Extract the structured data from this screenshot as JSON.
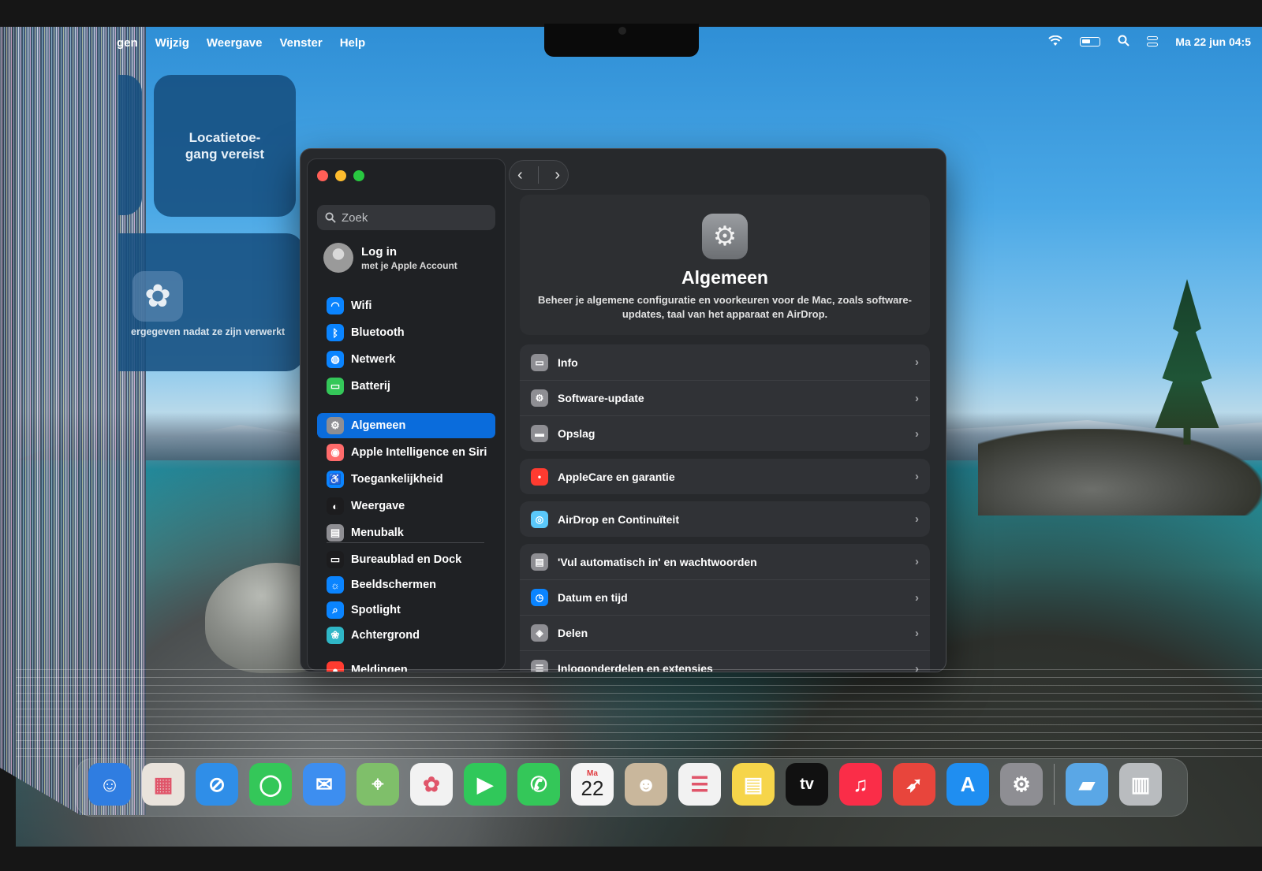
{
  "menubar": {
    "items": [
      "gen",
      "Wijzig",
      "Weergave",
      "Venster",
      "Help"
    ],
    "datetime": "Ma 22 jun 04:5"
  },
  "widgets": {
    "location_text": "Locatietoe-gang vereist",
    "photos_caption": "ergegeven nadat ze zijn verwerkt"
  },
  "sidebar": {
    "search_placeholder": "Zoek",
    "account": {
      "title": "Log in",
      "subtitle": "met je Apple Account"
    },
    "items": [
      {
        "label": "Wifi",
        "icon": "wifi-icon",
        "color": "#0a84ff"
      },
      {
        "label": "Bluetooth",
        "icon": "bluetooth-icon",
        "color": "#0a84ff"
      },
      {
        "label": "Netwerk",
        "icon": "globe-icon",
        "color": "#0a84ff"
      },
      {
        "label": "Batterij",
        "icon": "battery-icon",
        "color": "#34c759"
      },
      {
        "label": "Algemeen",
        "icon": "gear-icon",
        "color": "#8e8e93",
        "active": true
      },
      {
        "label": "Apple Intelligence en Siri",
        "icon": "siri-icon",
        "color": "#ff6b6b"
      },
      {
        "label": "Toegankelijkheid",
        "icon": "accessibility-icon",
        "color": "#0a84ff"
      },
      {
        "label": "Weergave",
        "icon": "appearance-icon",
        "color": "#1c1c1e"
      },
      {
        "label": "Menubalk",
        "icon": "menubar-icon",
        "color": "#8e8e93"
      },
      {
        "label": "Bureaublad en Dock",
        "icon": "dock-icon",
        "color": "#1c1c1e"
      },
      {
        "label": "Beeldschermen",
        "icon": "sun-icon",
        "color": "#0a84ff"
      },
      {
        "label": "Spotlight",
        "icon": "search-icon",
        "color": "#0a84ff"
      },
      {
        "label": "Achtergrond",
        "icon": "wallpaper-icon",
        "color": "#2fb7c7"
      },
      {
        "label": "Meldingen",
        "icon": "bell-icon",
        "color": "#ff3b30"
      }
    ]
  },
  "main": {
    "title": "Algemeen",
    "description": "Beheer je algemene configuratie en voorkeuren voor de Mac, zoals software-updates, taal van het apparaat en AirDrop.",
    "groups": [
      [
        {
          "label": "Info",
          "icon": "info-laptop-icon",
          "color": "#8e8e93"
        },
        {
          "label": "Software-update",
          "icon": "software-update-icon",
          "color": "#8e8e93"
        },
        {
          "label": "Opslag",
          "icon": "storage-icon",
          "color": "#8e8e93"
        }
      ],
      [
        {
          "label": "AppleCare en garantie",
          "icon": "applecare-icon",
          "color": "#ff3b30"
        }
      ],
      [
        {
          "label": "AirDrop en Continuïteit",
          "icon": "airdrop-icon",
          "color": "#5ac8fa"
        }
      ],
      [
        {
          "label": "'Vul automatisch in' en wachtwoorden",
          "icon": "autofill-icon",
          "color": "#8e8e93"
        },
        {
          "label": "Datum en tijd",
          "icon": "calendar-clock-icon",
          "color": "#0a84ff"
        },
        {
          "label": "Delen",
          "icon": "sharing-icon",
          "color": "#8e8e93"
        },
        {
          "label": "Inlogonderdelen en extensies",
          "icon": "login-items-icon",
          "color": "#8e8e93"
        }
      ]
    ]
  },
  "dock": {
    "calendar_day": "Ma",
    "calendar_date": "22",
    "tv_label": "tv",
    "apps": [
      {
        "name": "finder",
        "color": "#2f7de1"
      },
      {
        "name": "launchpad",
        "color": "#e9e3dc"
      },
      {
        "name": "safari",
        "color": "#2f8ee8"
      },
      {
        "name": "messages",
        "color": "#34c759"
      },
      {
        "name": "mail",
        "color": "#3d8ef0"
      },
      {
        "name": "maps",
        "color": "#7fbf6a"
      },
      {
        "name": "photos",
        "color": "#f2f2f2"
      },
      {
        "name": "facetime",
        "color": "#30c85a"
      },
      {
        "name": "phone",
        "color": "#34c759"
      },
      {
        "name": "calendar",
        "color": "#f4f4f4"
      },
      {
        "name": "contacts",
        "color": "#c9b79c"
      },
      {
        "name": "reminders",
        "color": "#f2f2f2"
      },
      {
        "name": "notes",
        "color": "#f6d54a"
      },
      {
        "name": "tv",
        "color": "#111111"
      },
      {
        "name": "music",
        "color": "#fa2d48"
      },
      {
        "name": "rocket",
        "color": "#e8453c"
      },
      {
        "name": "app-store",
        "color": "#1f8ef1"
      },
      {
        "name": "system-settings",
        "color": "#8e8e93"
      },
      {
        "name": "downloads-folder",
        "color": "#5aa7e6"
      },
      {
        "name": "trash",
        "color": "#b9bcbf"
      }
    ]
  }
}
